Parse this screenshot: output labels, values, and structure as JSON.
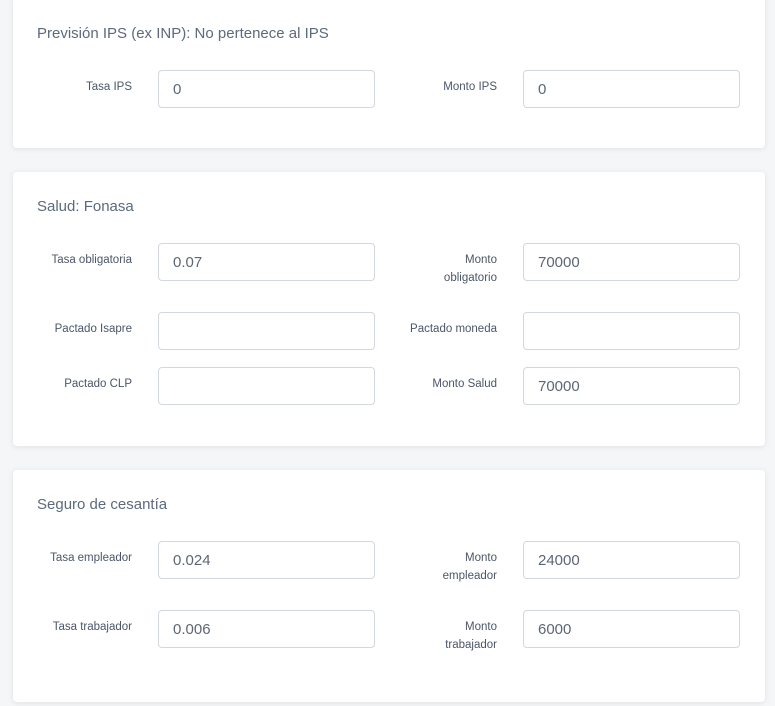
{
  "sections": {
    "ips": {
      "title": "Previsión IPS (ex INP): No pertenece al IPS",
      "tasa_label": "Tasa IPS",
      "tasa_value": "0",
      "monto_label": "Monto IPS",
      "monto_value": "0"
    },
    "salud": {
      "title": "Salud: Fonasa",
      "tasa_obligatoria_label": "Tasa obligatoria",
      "tasa_obligatoria_value": "0.07",
      "monto_obligatorio_label_1": "Monto",
      "monto_obligatorio_label_2": "obligatorio",
      "monto_obligatorio_value": "70000",
      "pactado_isapre_label": "Pactado Isapre",
      "pactado_isapre_value": "",
      "pactado_moneda_label": "Pactado moneda",
      "pactado_moneda_value": "",
      "pactado_clp_label": "Pactado CLP",
      "pactado_clp_value": "",
      "monto_salud_label": "Monto Salud",
      "monto_salud_value": "70000"
    },
    "cesantia": {
      "title": "Seguro de cesantía",
      "tasa_empleador_label": "Tasa empleador",
      "tasa_empleador_value": "0.024",
      "monto_empleador_label_1": "Monto",
      "monto_empleador_label_2": "empleador",
      "monto_empleador_value": "24000",
      "tasa_trabajador_label": "Tasa trabajador",
      "tasa_trabajador_value": "0.006",
      "monto_trabajador_label_1": "Monto",
      "monto_trabajador_label_2": "trabajador",
      "monto_trabajador_value": "6000"
    }
  }
}
